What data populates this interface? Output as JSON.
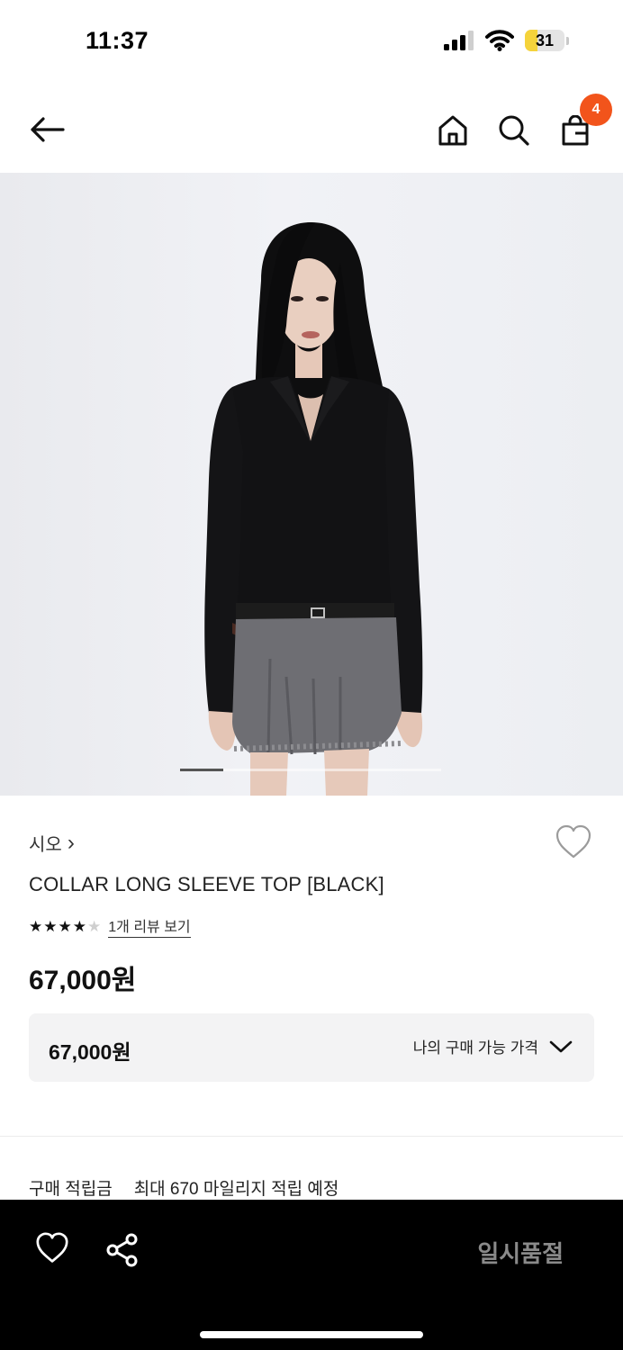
{
  "status_bar": {
    "time": "11:37",
    "battery": "31",
    "battery_level": 0.31,
    "battery_color": "#f5d33b"
  },
  "header": {
    "cart_count": "4",
    "badge_color": "#f2541b"
  },
  "gallery": {
    "image": "model-photo",
    "current_index": 1,
    "total": 6
  },
  "product": {
    "brand": "시오",
    "brand_chevron": "›",
    "title": "COLLAR LONG SLEEVE TOP [BLACK]",
    "rating": 4,
    "rating_max": 5,
    "review_link": "1개 리뷰 보기",
    "price": "67,000원"
  },
  "price_box": {
    "value": "67,000원",
    "my_price_label": "나의 구매 가능 가격"
  },
  "points": {
    "label": "구매 적립금",
    "value": "최대 670 마일리지 적립 예정"
  },
  "bottom_bar": {
    "soldout_label": "일시품절"
  },
  "icons": [
    "back-arrow-icon",
    "home-icon",
    "search-icon",
    "shopping-bag-icon",
    "heart-icon",
    "share-icon",
    "chevron-down-icon",
    "signal-icon",
    "wifi-icon"
  ]
}
